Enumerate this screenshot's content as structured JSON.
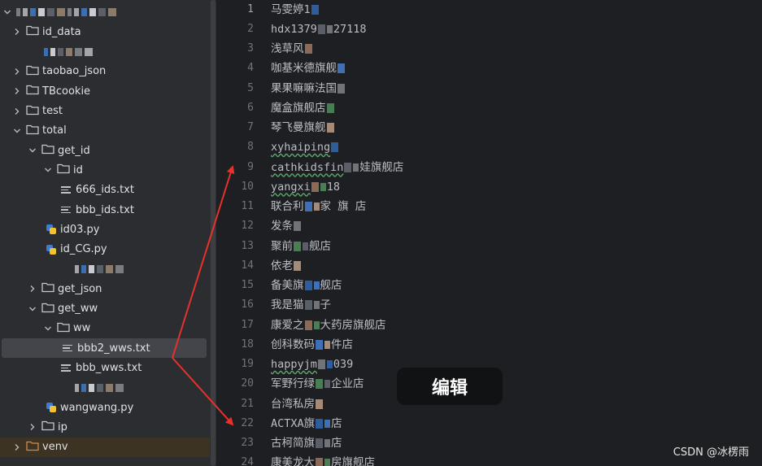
{
  "project_tree": {
    "items": [
      {
        "label": "",
        "depth": 0,
        "kind": "root",
        "expanded": true,
        "blurred": true
      },
      {
        "label": "id_data",
        "depth": 1,
        "kind": "folder",
        "expanded": false
      },
      {
        "label": "",
        "depth": 1,
        "kind": "blurred"
      },
      {
        "label": "taobao_json",
        "depth": 1,
        "kind": "folder",
        "expanded": false
      },
      {
        "label": "TBcookie",
        "depth": 1,
        "kind": "folder",
        "expanded": false
      },
      {
        "label": "test",
        "depth": 1,
        "kind": "folder",
        "expanded": false
      },
      {
        "label": "total",
        "depth": 1,
        "kind": "folder",
        "expanded": true
      },
      {
        "label": "get_id",
        "depth": 2,
        "kind": "folder",
        "expanded": true
      },
      {
        "label": "id",
        "depth": 3,
        "kind": "folder",
        "expanded": true
      },
      {
        "label": "666_ids.txt",
        "depth": 4,
        "kind": "txt"
      },
      {
        "label": "bbb_ids.txt",
        "depth": 4,
        "kind": "txt"
      },
      {
        "label": "id03.py",
        "depth": 3,
        "kind": "py"
      },
      {
        "label": "id_CG.py",
        "depth": 3,
        "kind": "py"
      },
      {
        "label": "",
        "depth": 3,
        "kind": "blurred"
      },
      {
        "label": "get_json",
        "depth": 2,
        "kind": "folder",
        "expanded": false
      },
      {
        "label": "get_ww",
        "depth": 2,
        "kind": "folder",
        "expanded": true
      },
      {
        "label": "ww",
        "depth": 3,
        "kind": "folder",
        "expanded": true
      },
      {
        "label": "bbb2_wws.txt",
        "depth": 4,
        "kind": "txt",
        "selected": true
      },
      {
        "label": "bbb_wws.txt",
        "depth": 4,
        "kind": "txt"
      },
      {
        "label": "",
        "depth": 3,
        "kind": "blurred"
      },
      {
        "label": "wangwang.py",
        "depth": 3,
        "kind": "py"
      },
      {
        "label": "ip",
        "depth": 2,
        "kind": "folder",
        "expanded": false
      },
      {
        "label": "venv",
        "depth": 1,
        "kind": "folder-orange",
        "expanded": false,
        "highlight": true
      }
    ]
  },
  "editor": {
    "current_line": 1,
    "lines": [
      {
        "n": "1",
        "text": "马雯婷1"
      },
      {
        "n": "2",
        "text": "hdx1379",
        "tail": "27118"
      },
      {
        "n": "3",
        "text": "浅草风"
      },
      {
        "n": "4",
        "text": "咖基米德旗舰"
      },
      {
        "n": "5",
        "text": "果果嘛嘛法国"
      },
      {
        "n": "6",
        "text": "魔盒旗舰店"
      },
      {
        "n": "7",
        "text": "琴飞曼旗舰"
      },
      {
        "n": "8",
        "text": "xyhaiping",
        "typo": true
      },
      {
        "n": "9",
        "text": "cathkidsfin",
        "tail": "娃旗舰店",
        "typo": true
      },
      {
        "n": "10",
        "text": "yangxi",
        "tail": "18",
        "typo": true
      },
      {
        "n": "11",
        "text": "联合利",
        "tail": "家 旗 店"
      },
      {
        "n": "12",
        "text": "发条"
      },
      {
        "n": "13",
        "text": "聚前",
        "tail": "舰店"
      },
      {
        "n": "14",
        "text": "依老"
      },
      {
        "n": "15",
        "text": "备美旗",
        "tail": "舰店"
      },
      {
        "n": "16",
        "text": "我是猫",
        "tail": "子"
      },
      {
        "n": "17",
        "text": "康爱之",
        "tail": "大药房旗舰店"
      },
      {
        "n": "18",
        "text": "创科数码",
        "tail": "件店"
      },
      {
        "n": "19",
        "text": "happyjm",
        "tail": "039",
        "typo": true
      },
      {
        "n": "20",
        "text": "军野行绿",
        "tail": "企业店"
      },
      {
        "n": "21",
        "text": "台湾私房"
      },
      {
        "n": "22",
        "text": "ACTXA旗",
        "tail": "店"
      },
      {
        "n": "23",
        "text": "古柯简旗",
        "tail": "店"
      },
      {
        "n": "24",
        "text": "康美龙大",
        "tail": "房旗舰店"
      }
    ]
  },
  "overlay": {
    "edit_button_label": "编辑",
    "watermark": "CSDN @冰楞雨"
  },
  "colors": {
    "arrow": "#e8312a",
    "folder": "#c5c7cc",
    "venv_folder": "#d08a4a",
    "py_blue": "#3d7bd4",
    "py_yellow": "#f2c230"
  }
}
